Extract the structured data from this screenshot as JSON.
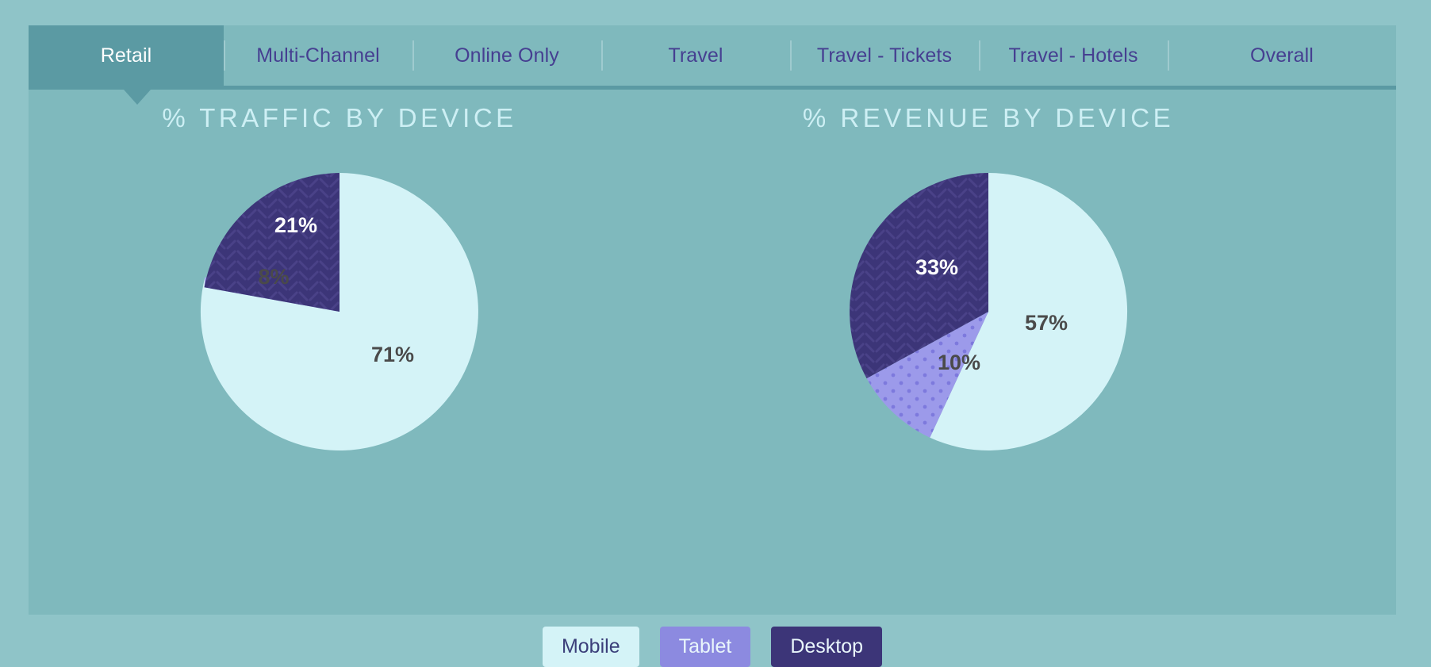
{
  "tabs": [
    {
      "label": "Retail",
      "active": true
    },
    {
      "label": "Multi-Channel",
      "active": false
    },
    {
      "label": "Online Only",
      "active": false
    },
    {
      "label": "Travel",
      "active": false
    },
    {
      "label": "Travel - Tickets",
      "active": false
    },
    {
      "label": "Travel - Hotels",
      "active": false
    },
    {
      "label": "Overall",
      "active": false
    }
  ],
  "legend": [
    {
      "label": "Mobile",
      "color": "#d4f3f7"
    },
    {
      "label": "Tablet",
      "color": "#8c8ae0"
    },
    {
      "label": "Desktop",
      "color": "#3c3578"
    }
  ],
  "colors": {
    "page_background": "#8fc4c8",
    "panel_background": "#7fb9bd",
    "active_tab": "#5b9aa3",
    "tab_text": "#463f91",
    "active_tab_text": "#ffffff",
    "title_text": "#cdeff4",
    "mobile": "#d4f3f7",
    "tablet": "#8c8ae0",
    "desktop": "#3c3578"
  },
  "charts": {
    "traffic": {
      "title": "% TRAFFIC BY DEVICE",
      "labels": [
        "71%",
        "8%",
        "21%"
      ]
    },
    "revenue": {
      "title": "% REVENUE BY DEVICE",
      "labels": [
        "57%",
        "10%",
        "33%"
      ]
    }
  },
  "chart_data": [
    {
      "type": "pie",
      "title": "% TRAFFIC BY DEVICE",
      "categories": [
        "Mobile",
        "Tablet",
        "Desktop"
      ],
      "values": [
        71,
        8,
        21
      ],
      "value_labels": [
        "71%",
        "8%",
        "21%"
      ],
      "colors": [
        "#d4f3f7",
        "#8c8ae0",
        "#3c3578"
      ],
      "patterns": [
        "solid",
        "dots",
        "diagonal-dashes"
      ],
      "start_angle_deg": 0,
      "direction": "clockwise",
      "legend_position": "bottom",
      "unit": "percent"
    },
    {
      "type": "pie",
      "title": "% REVENUE BY DEVICE",
      "categories": [
        "Mobile",
        "Tablet",
        "Desktop"
      ],
      "values": [
        57,
        10,
        33
      ],
      "value_labels": [
        "57%",
        "10%",
        "33%"
      ],
      "colors": [
        "#d4f3f7",
        "#8c8ae0",
        "#3c3578"
      ],
      "patterns": [
        "solid",
        "dots",
        "diagonal-dashes"
      ],
      "start_angle_deg": 0,
      "direction": "clockwise",
      "legend_position": "bottom",
      "unit": "percent"
    }
  ]
}
